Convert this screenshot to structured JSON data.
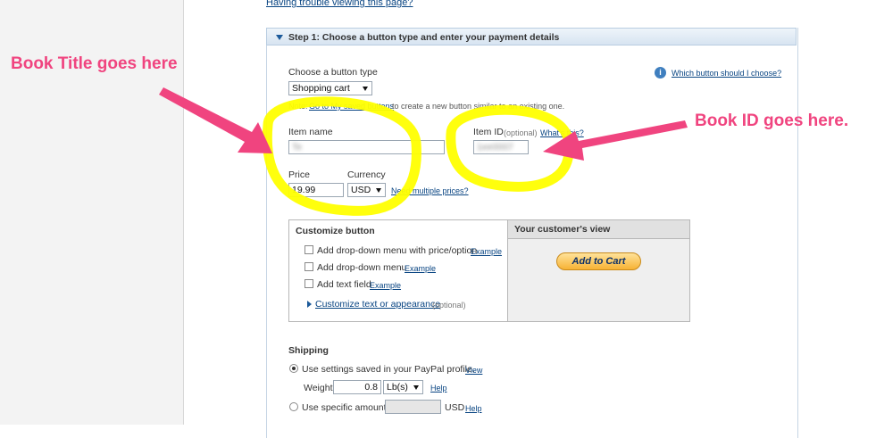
{
  "top_link": "Having trouble viewing this page?",
  "step1": {
    "title": "Step 1: Choose a button type and enter your payment details",
    "choose_type_label": "Choose a button type",
    "button_type_value": "Shopping cart",
    "help_link": "Which button should I choose?",
    "note_prefix": "Note:",
    "note_link": "Go to My saved buttons",
    "note_suffix": "to create a new button similar to an existing one.",
    "item_name_label": "Item name",
    "item_name_value": "Te              ",
    "item_id_label": "Item ID",
    "item_id_optional": "(optional)",
    "what_is_this": "What's this?",
    "item_id_value": "1ee0007",
    "price_label": "Price",
    "price_value": "19.99",
    "currency_label": "Currency",
    "currency_value": "USD",
    "multiple_prices_link": "Need multiple prices?"
  },
  "customize": {
    "title": "Customize button",
    "options": [
      {
        "label": "Add drop-down menu with price/option",
        "example": "Example"
      },
      {
        "label": "Add drop-down menu",
        "example": "Example"
      },
      {
        "label": "Add text field",
        "example": "Example"
      }
    ],
    "appearance_link": "Customize text or appearance",
    "appearance_optional": "(optional)"
  },
  "customer_view": {
    "title": "Your customer's view",
    "button_label": "Add to Cart"
  },
  "shipping": {
    "title": "Shipping",
    "option1_label": "Use settings saved in your PayPal profile.",
    "option1_link": "View",
    "weight_label": "Weight",
    "weight_value": "0.8",
    "weight_unit": "Lb(s)",
    "help": "Help",
    "option2_label": "Use specific amount:",
    "currency": "USD",
    "help2": "Help"
  },
  "annotations": {
    "book_title": "Book Title goes here",
    "book_id": "Book ID goes here."
  },
  "colors": {
    "annotation_pink": "#f0447f",
    "highlight_yellow": "#ffff00",
    "link_blue": "#084482"
  }
}
